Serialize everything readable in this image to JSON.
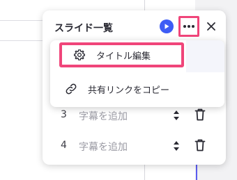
{
  "panel": {
    "title": "スライド一覧"
  },
  "toolbar": {
    "play_icon": "play-icon",
    "more_icon": "more-horizontal-icon",
    "close_icon": "close-icon"
  },
  "menu": {
    "items": [
      {
        "icon": "gear-icon",
        "label": "タイトル編集"
      },
      {
        "icon": "link-icon",
        "label": "共有リンクをコピー"
      }
    ]
  },
  "slides": [
    {
      "number": "3",
      "caption_placeholder": "字幕を追加"
    },
    {
      "number": "4",
      "caption_placeholder": "字幕を追加"
    }
  ],
  "colors": {
    "accent": "#3d5cf5",
    "highlight": "#f0457a",
    "divider_blue": "#5b5cf0"
  }
}
